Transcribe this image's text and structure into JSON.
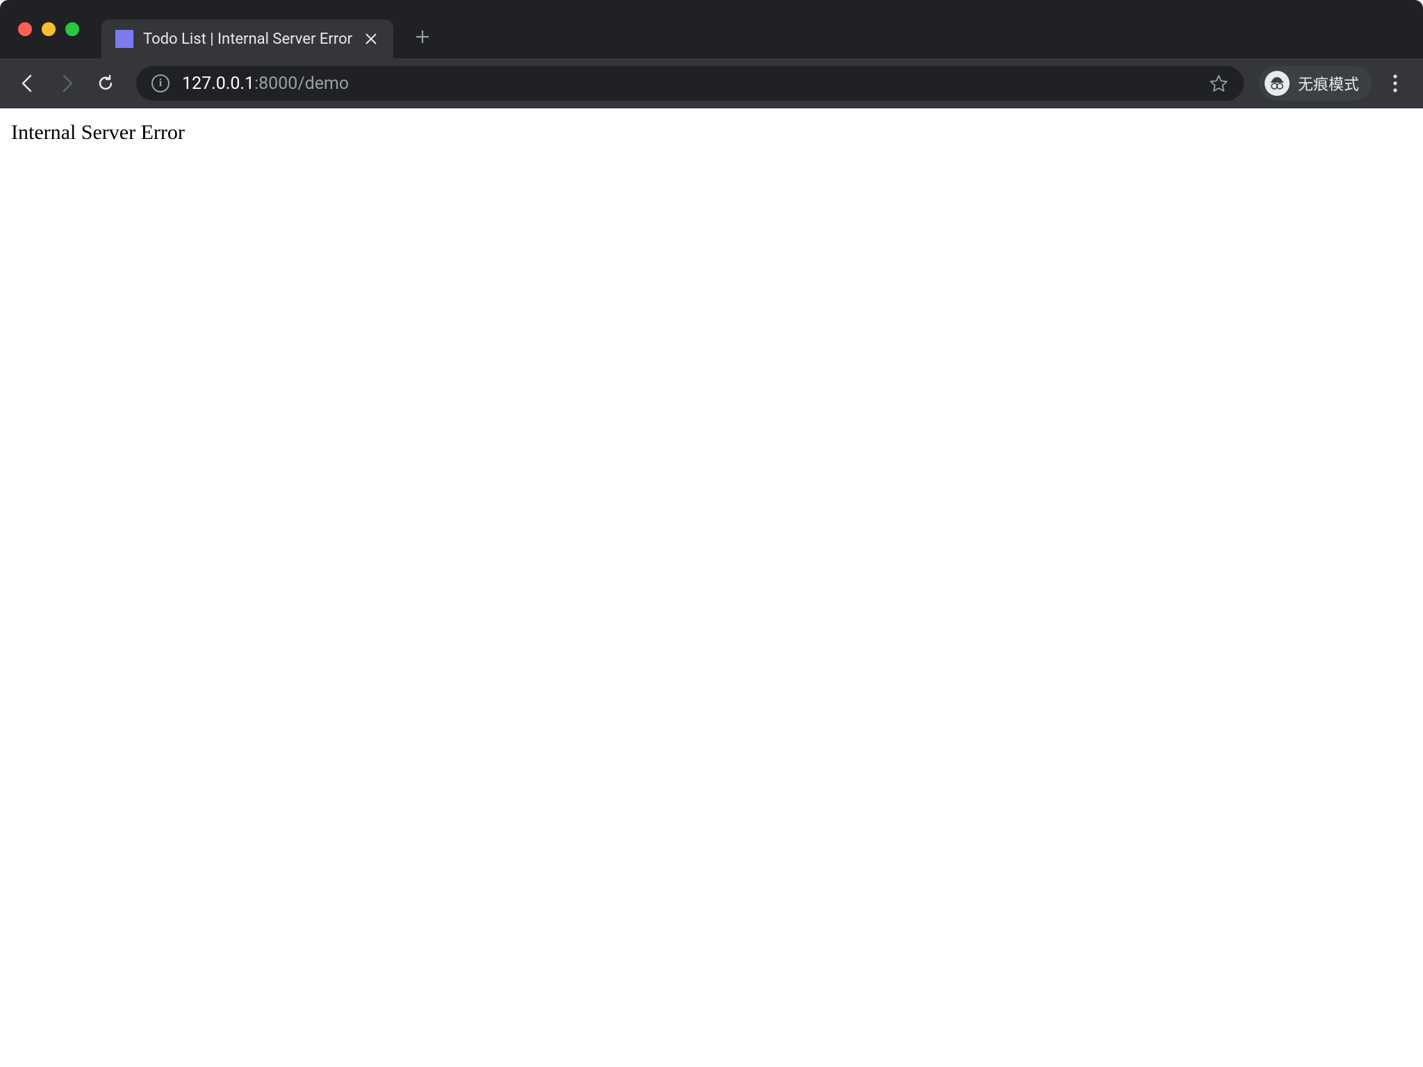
{
  "browser": {
    "tab": {
      "title": "Todo List | Internal Server Error",
      "favicon_color": "#7b7bef"
    },
    "url": {
      "host": "127.0.0.1",
      "port_path": ":8000/demo"
    },
    "incognito_label": "无痕模式"
  },
  "page": {
    "error_message": "Internal Server Error"
  }
}
